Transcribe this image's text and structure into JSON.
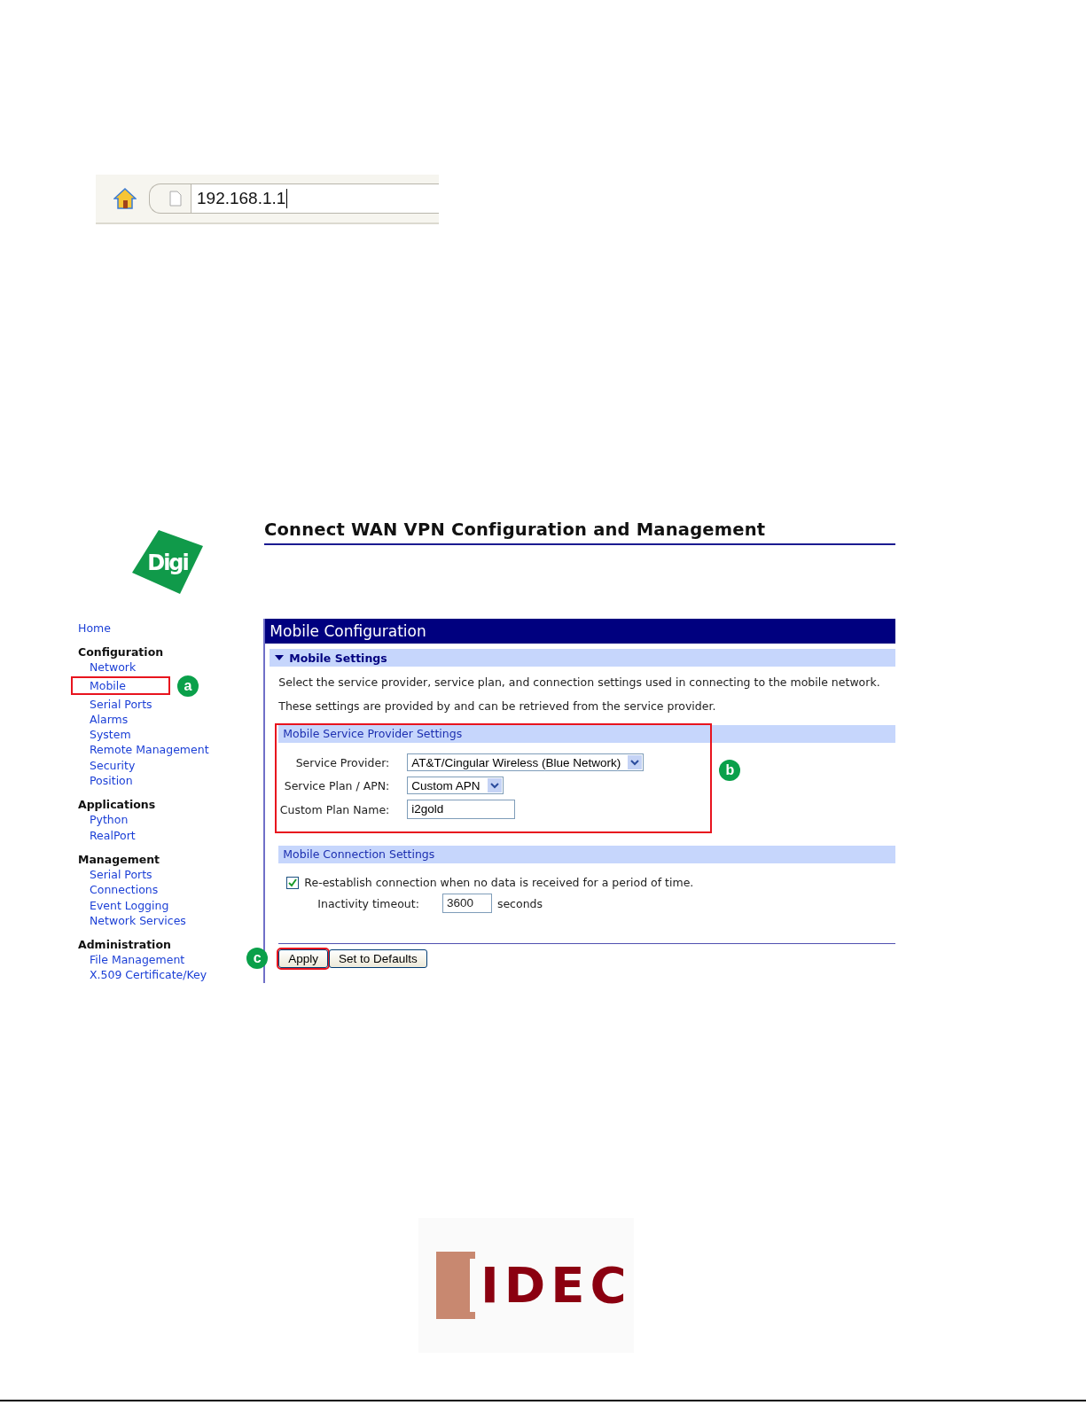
{
  "address_bar": {
    "url": "192.168.1.1"
  },
  "header": {
    "logo": "Digi",
    "title": "Connect WAN VPN Configuration and Management"
  },
  "sidebar": {
    "home": "Home",
    "sections": [
      {
        "title": "Configuration",
        "items": [
          {
            "label": "Network",
            "highlighted": false
          },
          {
            "label": "Mobile",
            "highlighted": true,
            "annotation": "a"
          },
          {
            "label": "Serial Ports",
            "highlighted": false
          },
          {
            "label": "Alarms",
            "highlighted": false
          },
          {
            "label": "System",
            "highlighted": false
          },
          {
            "label": "Remote Management",
            "highlighted": false
          },
          {
            "label": "Security",
            "highlighted": false
          },
          {
            "label": "Position",
            "highlighted": false
          }
        ]
      },
      {
        "title": "Applications",
        "items": [
          {
            "label": "Python",
            "highlighted": false
          },
          {
            "label": "RealPort",
            "highlighted": false
          }
        ]
      },
      {
        "title": "Management",
        "items": [
          {
            "label": "Serial Ports",
            "highlighted": false
          },
          {
            "label": "Connections",
            "highlighted": false
          },
          {
            "label": "Event Logging",
            "highlighted": false
          },
          {
            "label": "Network Services",
            "highlighted": false
          }
        ]
      },
      {
        "title": "Administration",
        "items": [
          {
            "label": "File Management",
            "highlighted": false
          },
          {
            "label": "X.509 Certificate/Key",
            "highlighted": false
          }
        ]
      }
    ]
  },
  "panel": {
    "title": "Mobile Configuration",
    "section": {
      "title": "Mobile Settings",
      "expanded": true
    },
    "intro": [
      "Select the service provider, service plan, and connection settings used in connecting to the mobile network.",
      "These settings are provided by and can be retrieved from the service provider."
    ],
    "provider_group": {
      "title": "Mobile Service Provider Settings",
      "highlighted": true,
      "annotation": "b",
      "fields": [
        {
          "kind": "select",
          "label": "Service Provider:",
          "value": "AT&T/Cingular Wireless (Blue Network)"
        },
        {
          "kind": "select",
          "label": "Service Plan / APN:",
          "value": "Custom APN"
        },
        {
          "kind": "text",
          "label": "Custom Plan Name:",
          "value": "i2gold"
        }
      ]
    },
    "connection_group": {
      "title": "Mobile Connection Settings",
      "checkbox": {
        "label": "Re-establish connection when no data is received for a period of time.",
        "checked": true
      },
      "timeout": {
        "label": "Inactivity timeout:",
        "value": "3600",
        "unit": "seconds"
      }
    },
    "buttons": [
      {
        "label": "Apply",
        "highlighted": true,
        "annotation": "c"
      },
      {
        "label": "Set to Defaults",
        "highlighted": false
      }
    ]
  },
  "footer_logo": "IDEC"
}
